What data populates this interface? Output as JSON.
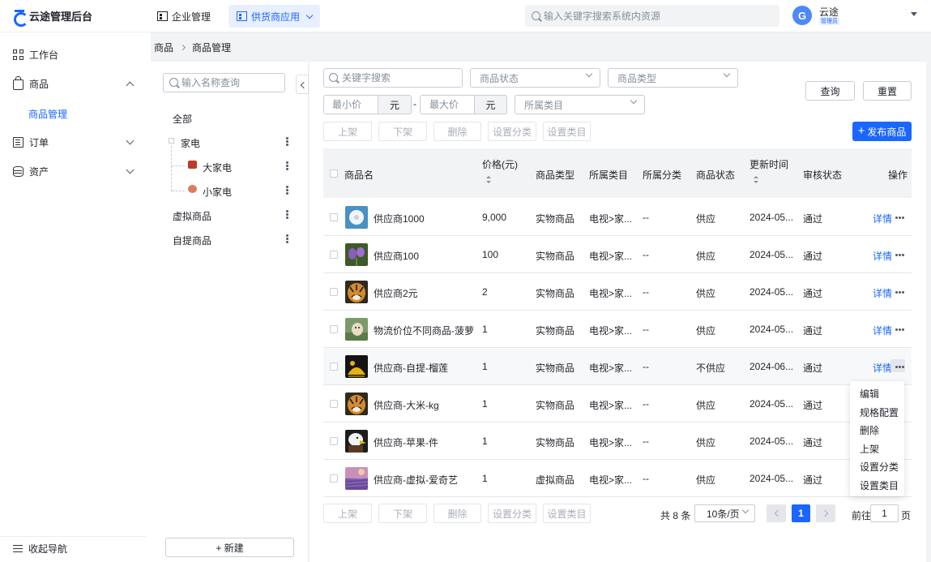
{
  "app": {
    "title": "云途管理后台"
  },
  "topnav": {
    "enterprise": "企业管理",
    "supply": "供货商应用"
  },
  "search": {
    "placeholder": "输入关键字搜索系统内资源"
  },
  "user": {
    "initial": "G",
    "name": "云途",
    "role": "管理员"
  },
  "sidebar": {
    "workbench": "工作台",
    "goods": "商品",
    "goods_manage": "商品管理",
    "orders": "订单",
    "assets": "资产",
    "collapse": "收起导航"
  },
  "breadcrumb": {
    "root": "商品",
    "current": "商品管理"
  },
  "tree": {
    "placeholder": "输入名称查询",
    "all": "全部",
    "appliance": "家电",
    "big_appliance": "大家电",
    "small_appliance": "小家电",
    "virtual": "虚拟商品",
    "pickup": "自提商品",
    "new_button": "+ 新建"
  },
  "filters": {
    "keyword_placeholder": "关键字搜索",
    "status_placeholder": "商品状态",
    "type_placeholder": "商品类型",
    "min_price_placeholder": "最小价",
    "max_price_placeholder": "最大价",
    "currency": "元",
    "dash": "-",
    "category_placeholder": "所属类目",
    "query_button": "查询",
    "reset_button": "重置"
  },
  "actions": {
    "on_shelf": "上架",
    "off_shelf": "下架",
    "delete": "删除",
    "set_class": "设置分类",
    "set_category": "设置类目",
    "publish": "发布商品"
  },
  "table": {
    "headers": {
      "name": "商品名",
      "price": "价格(元)",
      "type": "商品类型",
      "category": "所属类目",
      "class": "所属分类",
      "status": "商品状态",
      "updated": "更新时间",
      "review": "审核状态",
      "ops": "操作"
    },
    "detail_label": "详情",
    "rows": [
      {
        "name": "供应商1000",
        "price": "9,000",
        "type": "实物商品",
        "category": "电视>家...",
        "class": "--",
        "status": "供应",
        "updated": "2024-05...",
        "review": "通过",
        "thumb": "dandelion"
      },
      {
        "name": "供应商100",
        "price": "100",
        "type": "实物商品",
        "category": "电视>家...",
        "class": "--",
        "status": "供应",
        "updated": "2024-05...",
        "review": "通过",
        "thumb": "iris"
      },
      {
        "name": "供应商2元",
        "price": "2",
        "type": "实物商品",
        "category": "电视>家...",
        "class": "--",
        "status": "供应",
        "updated": "2024-05...",
        "review": "通过",
        "thumb": "tiger"
      },
      {
        "name": "物流价位不同商品-菠萝",
        "price": "1",
        "type": "实物商品",
        "category": "电视>家...",
        "class": "--",
        "status": "供应",
        "updated": "2024-05...",
        "review": "通过",
        "thumb": "dog"
      },
      {
        "name": "供应商-自提-榴莲",
        "price": "1",
        "type": "实物商品",
        "category": "电视>家...",
        "class": "--",
        "status": "不供应",
        "updated": "2024-06...",
        "review": "通过",
        "thumb": "bird"
      },
      {
        "name": "供应商-大米-kg",
        "price": "1",
        "type": "实物商品",
        "category": "电视>家...",
        "class": "--",
        "status": "供应",
        "updated": "2024-05...",
        "review": "通过",
        "thumb": "tiger"
      },
      {
        "name": "供应商-苹果-件",
        "price": "1",
        "type": "实物商品",
        "category": "电视>家...",
        "class": "--",
        "status": "供应",
        "updated": "2024-05...",
        "review": "通过",
        "thumb": "eagle"
      },
      {
        "name": "供应商-虚拟-爱奇艺",
        "price": "1",
        "type": "虚拟商品",
        "category": "电视>家...",
        "class": "--",
        "status": "供应",
        "updated": "2024-05...",
        "review": "通过",
        "thumb": "lavender"
      }
    ]
  },
  "row_menu": [
    "编辑",
    "规格配置",
    "删除",
    "上架",
    "设置分类",
    "设置类目"
  ],
  "pagination": {
    "total": "共 8 条",
    "page_size": "10条/页",
    "current_page": "1",
    "goto_label": "前往",
    "goto_value": "1",
    "page_suffix": "页"
  },
  "colors": {
    "primary": "#1a66ff",
    "background": "#f2f3f5"
  }
}
